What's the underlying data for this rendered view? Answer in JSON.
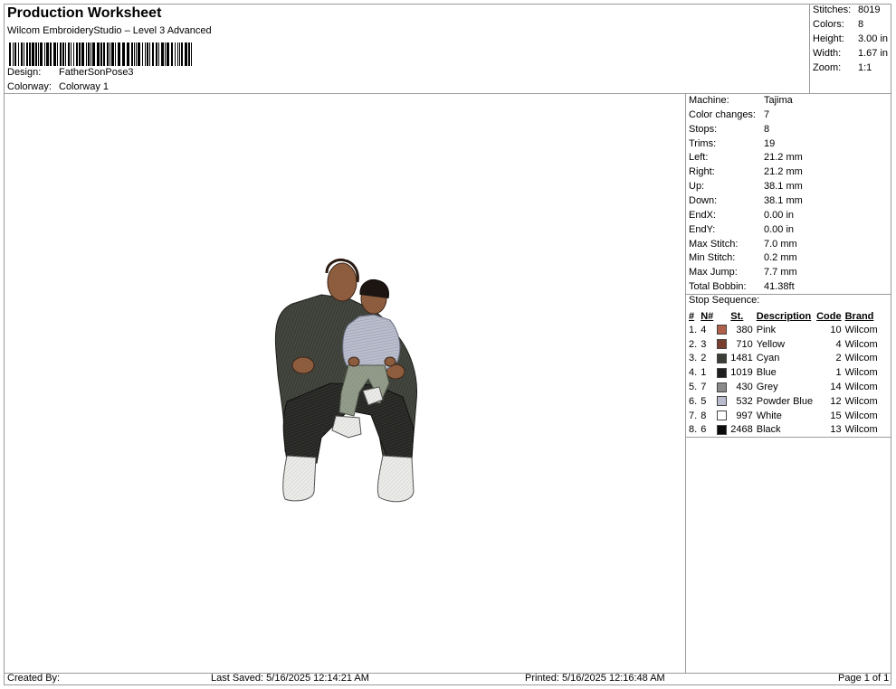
{
  "header": {
    "title": "Production Worksheet",
    "software": "Wilcom EmbroideryStudio – Level 3 Advanced",
    "design_label": "Design:",
    "design_value": "FatherSonPose3",
    "colorway_label": "Colorway:",
    "colorway_value": "Colorway 1"
  },
  "summary": {
    "stitches_label": "Stitches:",
    "stitches": "8019",
    "colors_label": "Colors:",
    "colors": "8",
    "height_label": "Height:",
    "height": "3.00 in",
    "width_label": "Width:",
    "width": "1.67 in",
    "zoom_label": "Zoom:",
    "zoom": "1:1"
  },
  "machine_info": [
    {
      "label": "Machine:",
      "value": "Tajima"
    },
    {
      "label": "Color changes:",
      "value": "7"
    },
    {
      "label": "Stops:",
      "value": "8"
    },
    {
      "label": "Trims:",
      "value": "19"
    },
    {
      "label": "Left:",
      "value": "21.2 mm"
    },
    {
      "label": "Right:",
      "value": "21.2 mm"
    },
    {
      "label": "Up:",
      "value": "38.1 mm"
    },
    {
      "label": "Down:",
      "value": "38.1 mm"
    },
    {
      "label": "EndX:",
      "value": "0.00 in"
    },
    {
      "label": "EndY:",
      "value": "0.00 in"
    },
    {
      "label": "Max Stitch:",
      "value": "7.0 mm"
    },
    {
      "label": "Min Stitch:",
      "value": "0.2 mm"
    },
    {
      "label": "Max Jump:",
      "value": "7.7 mm"
    },
    {
      "label": "Total Bobbin:",
      "value": "41.38ft"
    }
  ],
  "stop_sequence": {
    "title": "Stop Sequence:",
    "headers": {
      "num": "#",
      "n": "N#",
      "st": "St.",
      "desc": "Description",
      "code": "Code",
      "brand": "Brand"
    },
    "rows": [
      {
        "num": "1.",
        "n": "4",
        "color": "#b0604a",
        "st": "380",
        "desc": "Pink",
        "code": "10",
        "brand": "Wilcom"
      },
      {
        "num": "2.",
        "n": "3",
        "color": "#7a3e2c",
        "st": "710",
        "desc": "Yellow",
        "code": "4",
        "brand": "Wilcom"
      },
      {
        "num": "3.",
        "n": "2",
        "color": "#3a3d36",
        "st": "1481",
        "desc": "Cyan",
        "code": "2",
        "brand": "Wilcom"
      },
      {
        "num": "4.",
        "n": "1",
        "color": "#1e1e1e",
        "st": "1019",
        "desc": "Blue",
        "code": "1",
        "brand": "Wilcom"
      },
      {
        "num": "5.",
        "n": "7",
        "color": "#8a8a8a",
        "st": "430",
        "desc": "Grey",
        "code": "14",
        "brand": "Wilcom"
      },
      {
        "num": "6.",
        "n": "5",
        "color": "#b8bccc",
        "st": "532",
        "desc": "Powder Blue",
        "code": "12",
        "brand": "Wilcom"
      },
      {
        "num": "7.",
        "n": "8",
        "color": "#ffffff",
        "st": "997",
        "desc": "White",
        "code": "15",
        "brand": "Wilcom"
      },
      {
        "num": "8.",
        "n": "6",
        "color": "#0a0a0a",
        "st": "2468",
        "desc": "Black",
        "code": "13",
        "brand": "Wilcom"
      }
    ]
  },
  "footer": {
    "created_by": "Created By:",
    "last_saved": "Last Saved: 5/16/2025 12:14:21 AM",
    "printed": "Printed: 5/16/2025 12:16:48 AM",
    "page": "Page 1 of 1"
  }
}
